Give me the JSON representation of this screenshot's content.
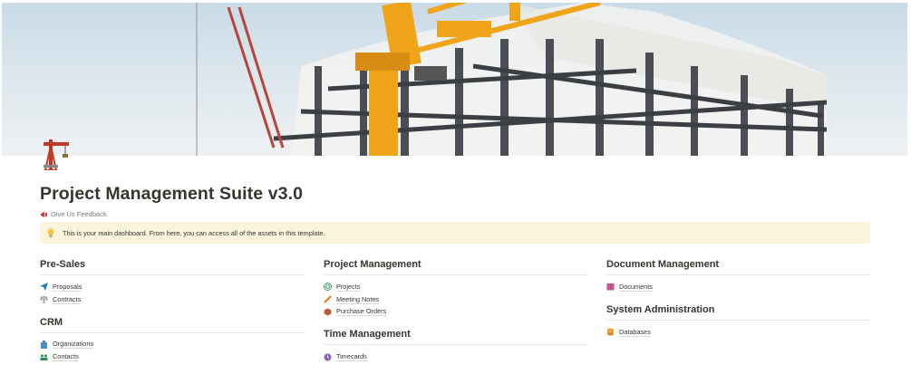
{
  "page": {
    "title": "Project Management Suite v3.0",
    "feedback_label": "Give Us Feedback",
    "callout_text": "This is your main dashboard.  From here, you can access all of the assets in this template.",
    "icons": {
      "page": "crane-icon",
      "feedback": "megaphone-icon",
      "callout": "lightbulb-icon"
    }
  },
  "sections": {
    "presales": {
      "heading": "Pre-Sales",
      "items": [
        {
          "label": "Proposals",
          "icon": "paper-plane-icon"
        },
        {
          "label": "Contracts",
          "icon": "scales-icon"
        }
      ]
    },
    "crm": {
      "heading": "CRM",
      "items": [
        {
          "label": "Organizations",
          "icon": "office-building-icon"
        },
        {
          "label": "Contacts",
          "icon": "people-icon"
        }
      ]
    },
    "project_management": {
      "heading": "Project Management",
      "items": [
        {
          "label": "Projects",
          "icon": "target-icon"
        },
        {
          "label": "Meeting Notes",
          "icon": "pencil-icon"
        },
        {
          "label": "Purchase Orders",
          "icon": "package-icon"
        }
      ]
    },
    "time_management": {
      "heading": "Time Management",
      "items": [
        {
          "label": "Timecards",
          "icon": "clock-icon"
        }
      ]
    },
    "document_management": {
      "heading": "Document Management",
      "items": [
        {
          "label": "Documents",
          "icon": "books-icon"
        }
      ]
    },
    "system_administration": {
      "heading": "System Administration",
      "items": [
        {
          "label": "Databases",
          "icon": "database-icon"
        }
      ]
    }
  },
  "colors": {
    "callout_bg": "#fbf3db",
    "crane_orange": "#f0a419",
    "text": "#37352f",
    "muted": "#787774"
  }
}
